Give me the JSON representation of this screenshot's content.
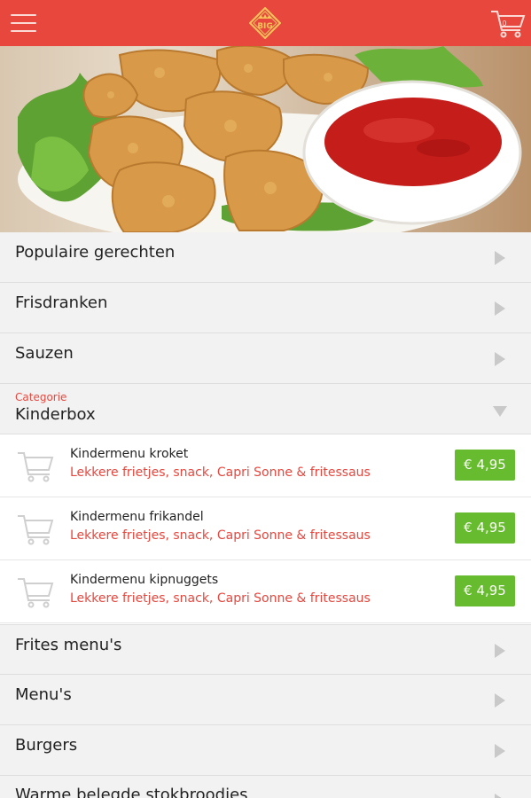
{
  "header": {
    "menu_icon": "hamburger-menu-icon",
    "logo_text": "BIG",
    "cart_icon": "shopping-cart-icon",
    "cart_count": "0",
    "accent_color": "#e8473e"
  },
  "hero": {
    "image": "chicken-nuggets-with-ketchup"
  },
  "categories_top": [
    {
      "label": "Populaire gerechten",
      "icon": "chevron-right-icon"
    },
    {
      "label": "Frisdranken",
      "icon": "chevron-right-icon"
    },
    {
      "label": "Sauzen",
      "icon": "chevron-right-icon"
    }
  ],
  "expanded_category": {
    "caption": "Categorie",
    "label": "Kinderbox",
    "icon": "chevron-down-icon",
    "products": [
      {
        "name": "Kindermenu kroket",
        "description": "Lekkere frietjes, snack, Capri Sonne & fritessaus",
        "price": "€ 4,95",
        "icon": "cart-icon"
      },
      {
        "name": "Kindermenu frikandel",
        "description": "Lekkere frietjes, snack, Capri Sonne & fritessaus",
        "price": "€ 4,95",
        "icon": "cart-icon"
      },
      {
        "name": "Kindermenu kipnuggets",
        "description": "Lekkere frietjes, snack, Capri Sonne & fritessaus",
        "price": "€ 4,95",
        "icon": "cart-icon"
      }
    ],
    "price_color": "#66bb2e"
  },
  "categories_bottom": [
    {
      "label": "Frites menu's",
      "icon": "chevron-right-icon"
    },
    {
      "label": "Menu's",
      "icon": "chevron-right-icon"
    },
    {
      "label": "Burgers",
      "icon": "chevron-right-icon"
    },
    {
      "label": "Warme belegde stokbroodjes",
      "icon": "chevron-right-icon"
    }
  ]
}
